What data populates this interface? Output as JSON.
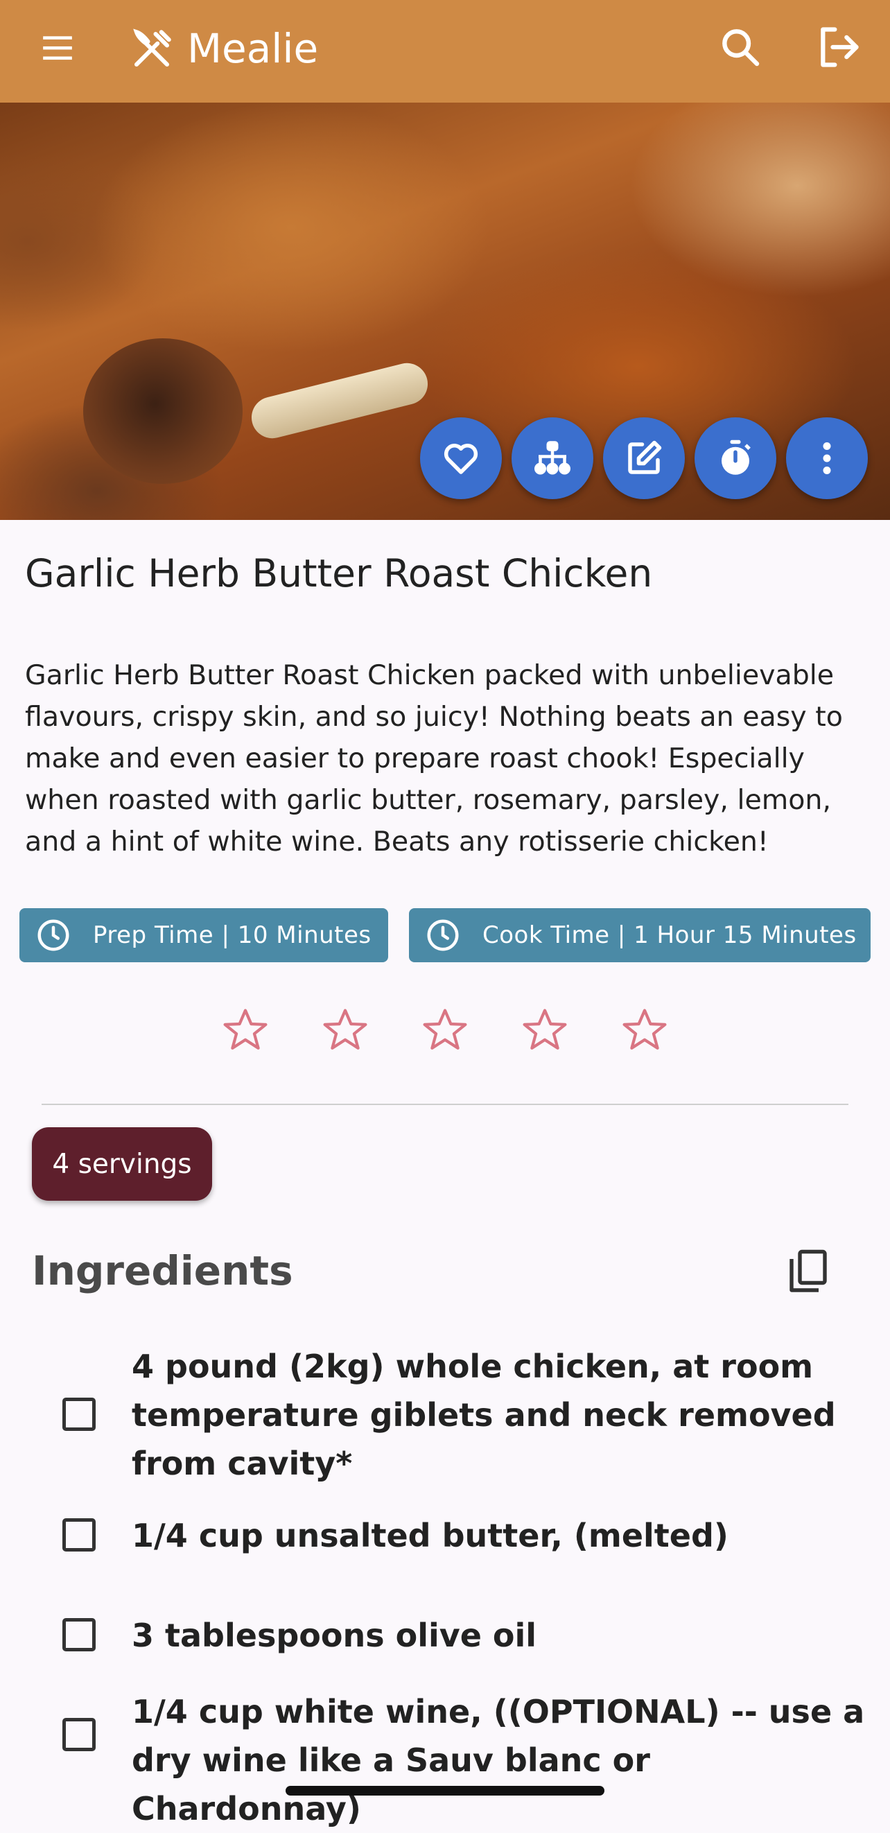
{
  "app": {
    "title": "Mealie",
    "brand_color": "#cf8a45",
    "icons": {
      "menu": "menu-icon",
      "logo": "fork-knife-icon",
      "search": "search-icon",
      "logout": "logout-icon"
    }
  },
  "actions": [
    {
      "name": "favorite",
      "icon": "heart-icon"
    },
    {
      "name": "recipe-tree",
      "icon": "sitemap-icon"
    },
    {
      "name": "edit",
      "icon": "pencil-icon"
    },
    {
      "name": "timer",
      "icon": "timer-icon"
    },
    {
      "name": "more",
      "icon": "dots-vertical-icon"
    }
  ],
  "recipe": {
    "title": "Garlic Herb Butter Roast Chicken",
    "description": "Garlic Herb Butter Roast Chicken packed with unbelievable flavours, crispy skin, and so juicy! Nothing beats an easy to make and even easier to prepare roast chook! Especially when roasted with garlic butter, rosemary, parsley, lemon, and a hint of white wine. Beats any rotisserie chicken!",
    "prep_time": "Prep Time | 10 Minutes",
    "cook_time": "Cook Time | 1 Hour 15 Minutes",
    "rating": {
      "value": 0,
      "max": 5
    },
    "servings": "4 servings"
  },
  "ingredients": {
    "heading": "Ingredients",
    "items": [
      "4 pound (2kg) whole chicken, at room temperature giblets and neck removed from cavity*",
      "1/4 cup unsalted butter, (melted)",
      "3 tablespoons olive oil",
      "1/4 cup white wine, ((OPTIONAL) -- use a dry wine like a Sauv blanc or Chardonnay)"
    ]
  },
  "colors": {
    "fab": "#3b6fce",
    "chip": "#4b8aa6",
    "servings": "#5e1f2c",
    "star": "#d97583"
  }
}
